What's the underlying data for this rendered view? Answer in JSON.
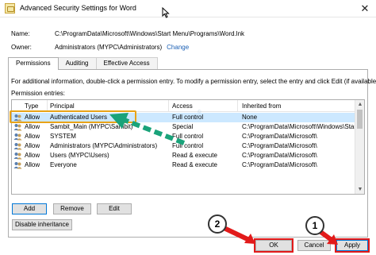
{
  "window": {
    "title": "Advanced Security Settings for Word"
  },
  "info": {
    "name_label": "Name:",
    "name_value": "C:\\ProgramData\\Microsoft\\Windows\\Start Menu\\Programs\\Word.lnk",
    "owner_label": "Owner:",
    "owner_value": "Administrators (MYPC\\Administrators)",
    "owner_change": "Change"
  },
  "tabs": [
    {
      "label": "Permissions",
      "active": true
    },
    {
      "label": "Auditing",
      "active": false
    },
    {
      "label": "Effective Access",
      "active": false
    }
  ],
  "instructions": "For additional information, double-click a permission entry. To modify a permission entry, select the entry and click Edit (if available).",
  "entries_label": "Permission entries:",
  "table": {
    "headers": [
      "Type",
      "Principal",
      "Access",
      "Inherited from"
    ],
    "rows": [
      {
        "type": "Allow",
        "principal": "Authenticated Users",
        "access": "Full control",
        "inherited": "None"
      },
      {
        "type": "Allow",
        "principal": "Sambit_Main (MYPC\\Sambit)",
        "access": "Special",
        "inherited": "C:\\ProgramData\\Microsoft\\Windows\\Start Menu\\"
      },
      {
        "type": "Allow",
        "principal": "SYSTEM",
        "access": "Full control",
        "inherited": "C:\\ProgramData\\Microsoft\\"
      },
      {
        "type": "Allow",
        "principal": "Administrators (MYPC\\Administrators)",
        "access": "Full control",
        "inherited": "C:\\ProgramData\\Microsoft\\"
      },
      {
        "type": "Allow",
        "principal": "Users (MYPC\\Users)",
        "access": "Read & execute",
        "inherited": "C:\\ProgramData\\Microsoft\\"
      },
      {
        "type": "Allow",
        "principal": "Everyone",
        "access": "Read & execute",
        "inherited": "C:\\ProgramData\\Microsoft\\"
      }
    ]
  },
  "buttons": {
    "add": "Add",
    "remove": "Remove",
    "edit": "Edit",
    "disable_inheritance": "Disable inheritance",
    "ok": "OK",
    "cancel": "Cancel",
    "apply": "Apply"
  },
  "annotations": {
    "step1": "1",
    "step2": "2"
  },
  "colors": {
    "selection": "#cce8ff",
    "highlight": "#e8a317",
    "red": "#e21a1a",
    "arrow": "#1aa37a",
    "link": "#1a5fb4"
  },
  "icons": [
    "word-icon",
    "close-icon",
    "user-group-icon",
    "mouse-cursor-icon"
  ]
}
